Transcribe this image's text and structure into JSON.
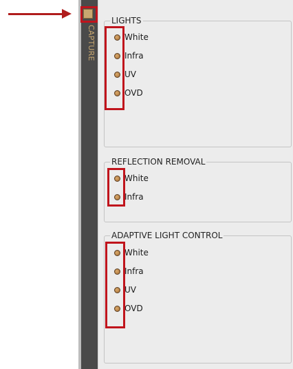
{
  "sidebar": {
    "label": "CAPTURE"
  },
  "groups": [
    {
      "title": "LIGHTS",
      "items": [
        "White",
        "Infra",
        "UV",
        "OVD"
      ]
    },
    {
      "title": "REFLECTION REMOVAL",
      "items": [
        "White",
        "Infra"
      ]
    },
    {
      "title": "ADAPTIVE LIGHT CONTROL",
      "items": [
        "White",
        "Infra",
        "UV",
        "OVD"
      ]
    }
  ],
  "colors": {
    "accent": "#c9a870",
    "annotation": "#c0141c",
    "sidebar_bg": "#4a4a4a",
    "panel_bg": "#ececec"
  }
}
